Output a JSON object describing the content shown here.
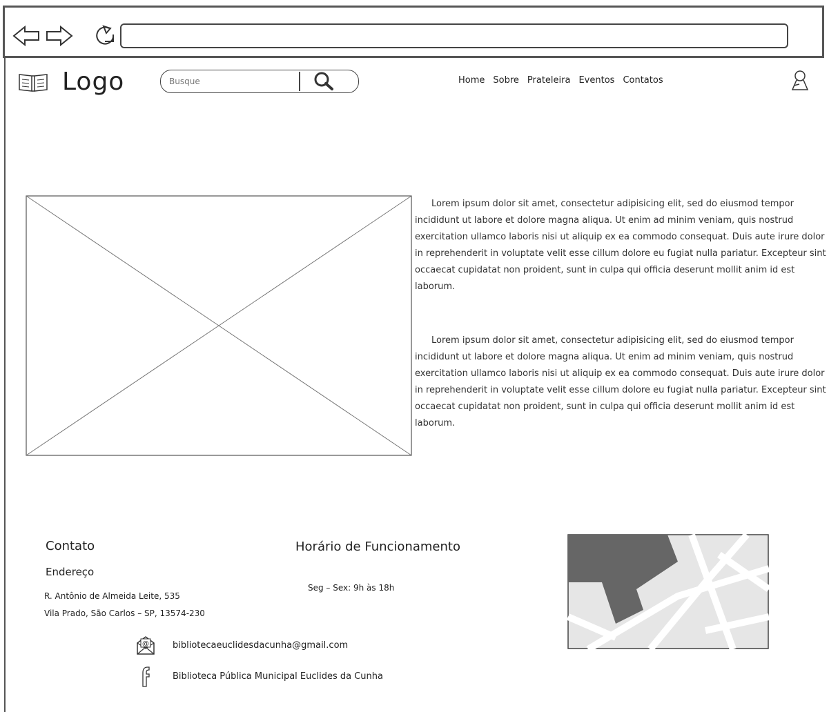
{
  "header": {
    "logo_text": "Logo",
    "search": {
      "placeholder": "Busque"
    },
    "nav": [
      "Home",
      "Sobre",
      "Prateleira",
      "Eventos",
      "Contatos"
    ]
  },
  "content": {
    "paragraphs": [
      "Lorem ipsum dolor sit amet, consectetur adipisicing elit, sed do eiusmod tempor incididunt ut labore et dolore magna aliqua. Ut enim ad minim veniam, quis nostrud exercitation ullamco laboris nisi ut aliquip ex ea commodo consequat. Duis aute irure dolor in reprehenderit in voluptate velit esse cillum dolore eu fugiat nulla pariatur. Excepteur sint occaecat cupidatat non proident, sunt in culpa qui officia deserunt mollit anim id est laborum.",
      "Lorem ipsum dolor sit amet, consectetur adipisicing elit, sed do eiusmod tempor incididunt ut labore et dolore magna aliqua. Ut enim ad minim veniam, quis nostrud exercitation ullamco laboris nisi ut aliquip ex ea commodo consequat. Duis aute irure dolor in reprehenderit in voluptate velit esse cillum dolore eu fugiat nulla pariatur. Excepteur sint occaecat cupidatat non proident, sunt in culpa qui officia deserunt mollit anim id est laborum."
    ]
  },
  "footer": {
    "contact_title": "Contato",
    "address_label": "Endereço",
    "address_line1": "R. Antônio de Almeida Leite, 535",
    "address_line2": "Vila Prado, São Carlos – SP, 13574-230",
    "hours_title": "Horário de Funcionamento",
    "hours": "Seg – Sex: 9h às 18h",
    "email": "bibliotecaeuclidesdacunha@gmail.com",
    "facebook": "Biblioteca Pública Municipal Euclides da Cunha"
  },
  "colors": {
    "map_block": "#666666",
    "map_bg": "#e6e6e6"
  }
}
